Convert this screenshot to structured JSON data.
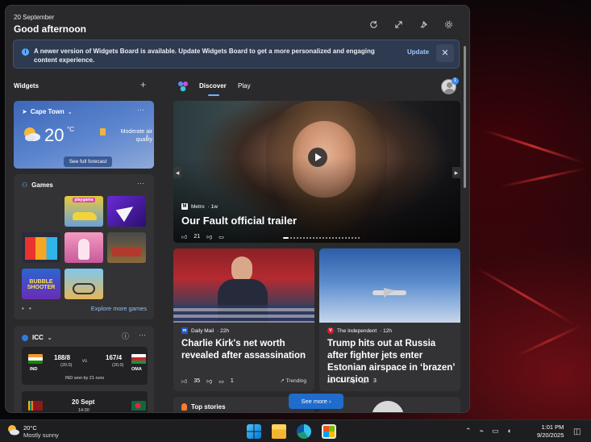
{
  "colors": {
    "board_bg": "#2a2a2c",
    "accent": "#1f6ccc",
    "link": "#8fbfff",
    "banner_bg": "#2e3a50"
  },
  "header": {
    "date": "20 September",
    "greeting": "Good afternoon",
    "icons": [
      "refresh-icon",
      "expand-icon",
      "pin-icon",
      "settings-icon"
    ]
  },
  "banner": {
    "message": "A newer version of Widgets Board is available. Update Widgets Board to get a more personalized and engaging content experience.",
    "update_label": "Update",
    "close_label": "✕"
  },
  "widgets": {
    "section_label": "Widgets",
    "add_label": "+",
    "weather": {
      "location": "Cape Town",
      "temperature": "20",
      "unit": "°C",
      "condition": "Moderate air quality",
      "forecast_button": "See full forecast",
      "more": "···"
    },
    "games": {
      "title": "Games",
      "more": "···",
      "tiles": [
        {
          "label": "playgama"
        },
        {
          "label": ""
        },
        {
          "label": ""
        },
        {
          "label": ""
        },
        {
          "label": ""
        },
        {
          "label": "BUBBLE SHOOTER"
        },
        {
          "label": ""
        }
      ],
      "pager": "• •",
      "explore_label": "Explore more games"
    },
    "icc": {
      "title": "ICC",
      "info_icon": "ⓘ",
      "more": "···",
      "match1": {
        "team1": "IND",
        "score1": "188/8",
        "overs1": "(20.0)",
        "vs": "vs",
        "team2": "OMA",
        "score2": "167/4",
        "overs2": "(20.0)",
        "result": "IND won by 21 runs"
      },
      "match2": {
        "date": "20 Sept",
        "time": "14:30"
      }
    }
  },
  "feed": {
    "tabs": [
      {
        "label": "Discover",
        "active": true
      },
      {
        "label": "Play",
        "active": false
      }
    ],
    "avatar_badge": "1",
    "hero": {
      "source": "Metro",
      "age": "· 1w",
      "headline": "Our Fault official trailer",
      "likes": "21",
      "source_logo": "M"
    },
    "cards": [
      {
        "source": "Daily Mail",
        "age": "· 22h",
        "source_logo": "m",
        "headline": "Charlie Kirk's net worth revealed after assassination",
        "likes": "35",
        "comments": "1",
        "trend": "Trending"
      },
      {
        "source": "The Independent",
        "age": "· 12h",
        "source_logo": "V",
        "headline": "Trump hits out at Russia after fighter jets enter Estonian airspace in ‘brazen’ incursion",
        "likes": "1",
        "comments": "3"
      }
    ],
    "top_stories": "Top stories",
    "see_more": "See more"
  },
  "taskbar": {
    "weather_temp": "20°C",
    "weather_desc": "Mostly sunny",
    "apps": [
      "windows-start-icon",
      "file-explorer-icon",
      "edge-icon",
      "store-icon"
    ],
    "time": "1:01 PM",
    "date": "9/20/2025"
  }
}
